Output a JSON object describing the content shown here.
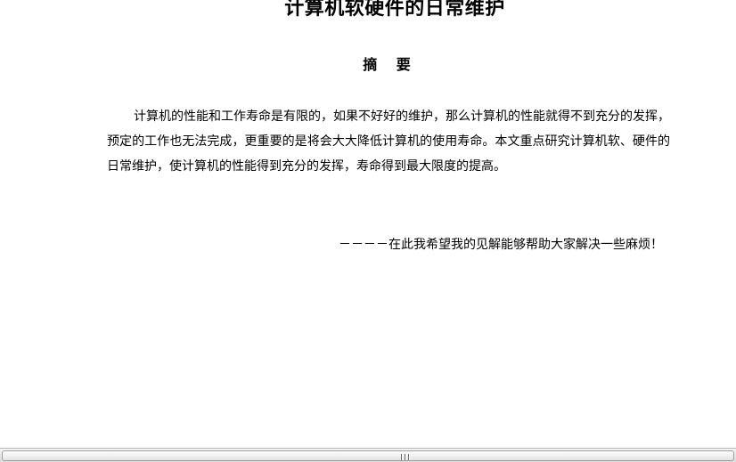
{
  "document": {
    "title": "计算机软硬件的日常维护",
    "abstract_heading": "摘 要",
    "abstract_body": "计算机的性能和工作寿命是有限的，如果不好好的维护，那么计算机的性能就得不到充分的发挥，预定的工作也无法完成，更重要的是将会大大降低计算机的使用寿命。本文重点研究计算机软、硬件的日常维护，使计算机的性能得到充分的发挥，寿命得到最大限度的提高。",
    "closing_line": "－－－－在此我希望我的见解能够帮助大家解决一些麻烦！"
  },
  "scrollbar": {
    "orientation": "horizontal",
    "grip_icon": "grip-lines-icon"
  }
}
